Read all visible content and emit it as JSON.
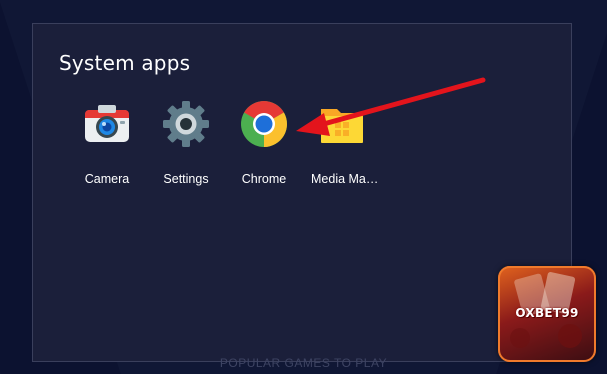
{
  "dialog": {
    "title": "System apps"
  },
  "apps": [
    {
      "label": "Camera",
      "icon": "camera-icon"
    },
    {
      "label": "Settings",
      "icon": "settings-gear-icon"
    },
    {
      "label": "Chrome",
      "icon": "chrome-icon"
    },
    {
      "label": "Media Ma…",
      "icon": "folder-icon"
    }
  ],
  "footer": {
    "text": "POPULAR GAMES TO PLAY"
  },
  "promo": {
    "text": "OXBET99"
  },
  "colors": {
    "background": "#101735",
    "dialog": "#1b1f3a",
    "arrow": "#e3141c",
    "promo_orange": "#e2641e"
  }
}
